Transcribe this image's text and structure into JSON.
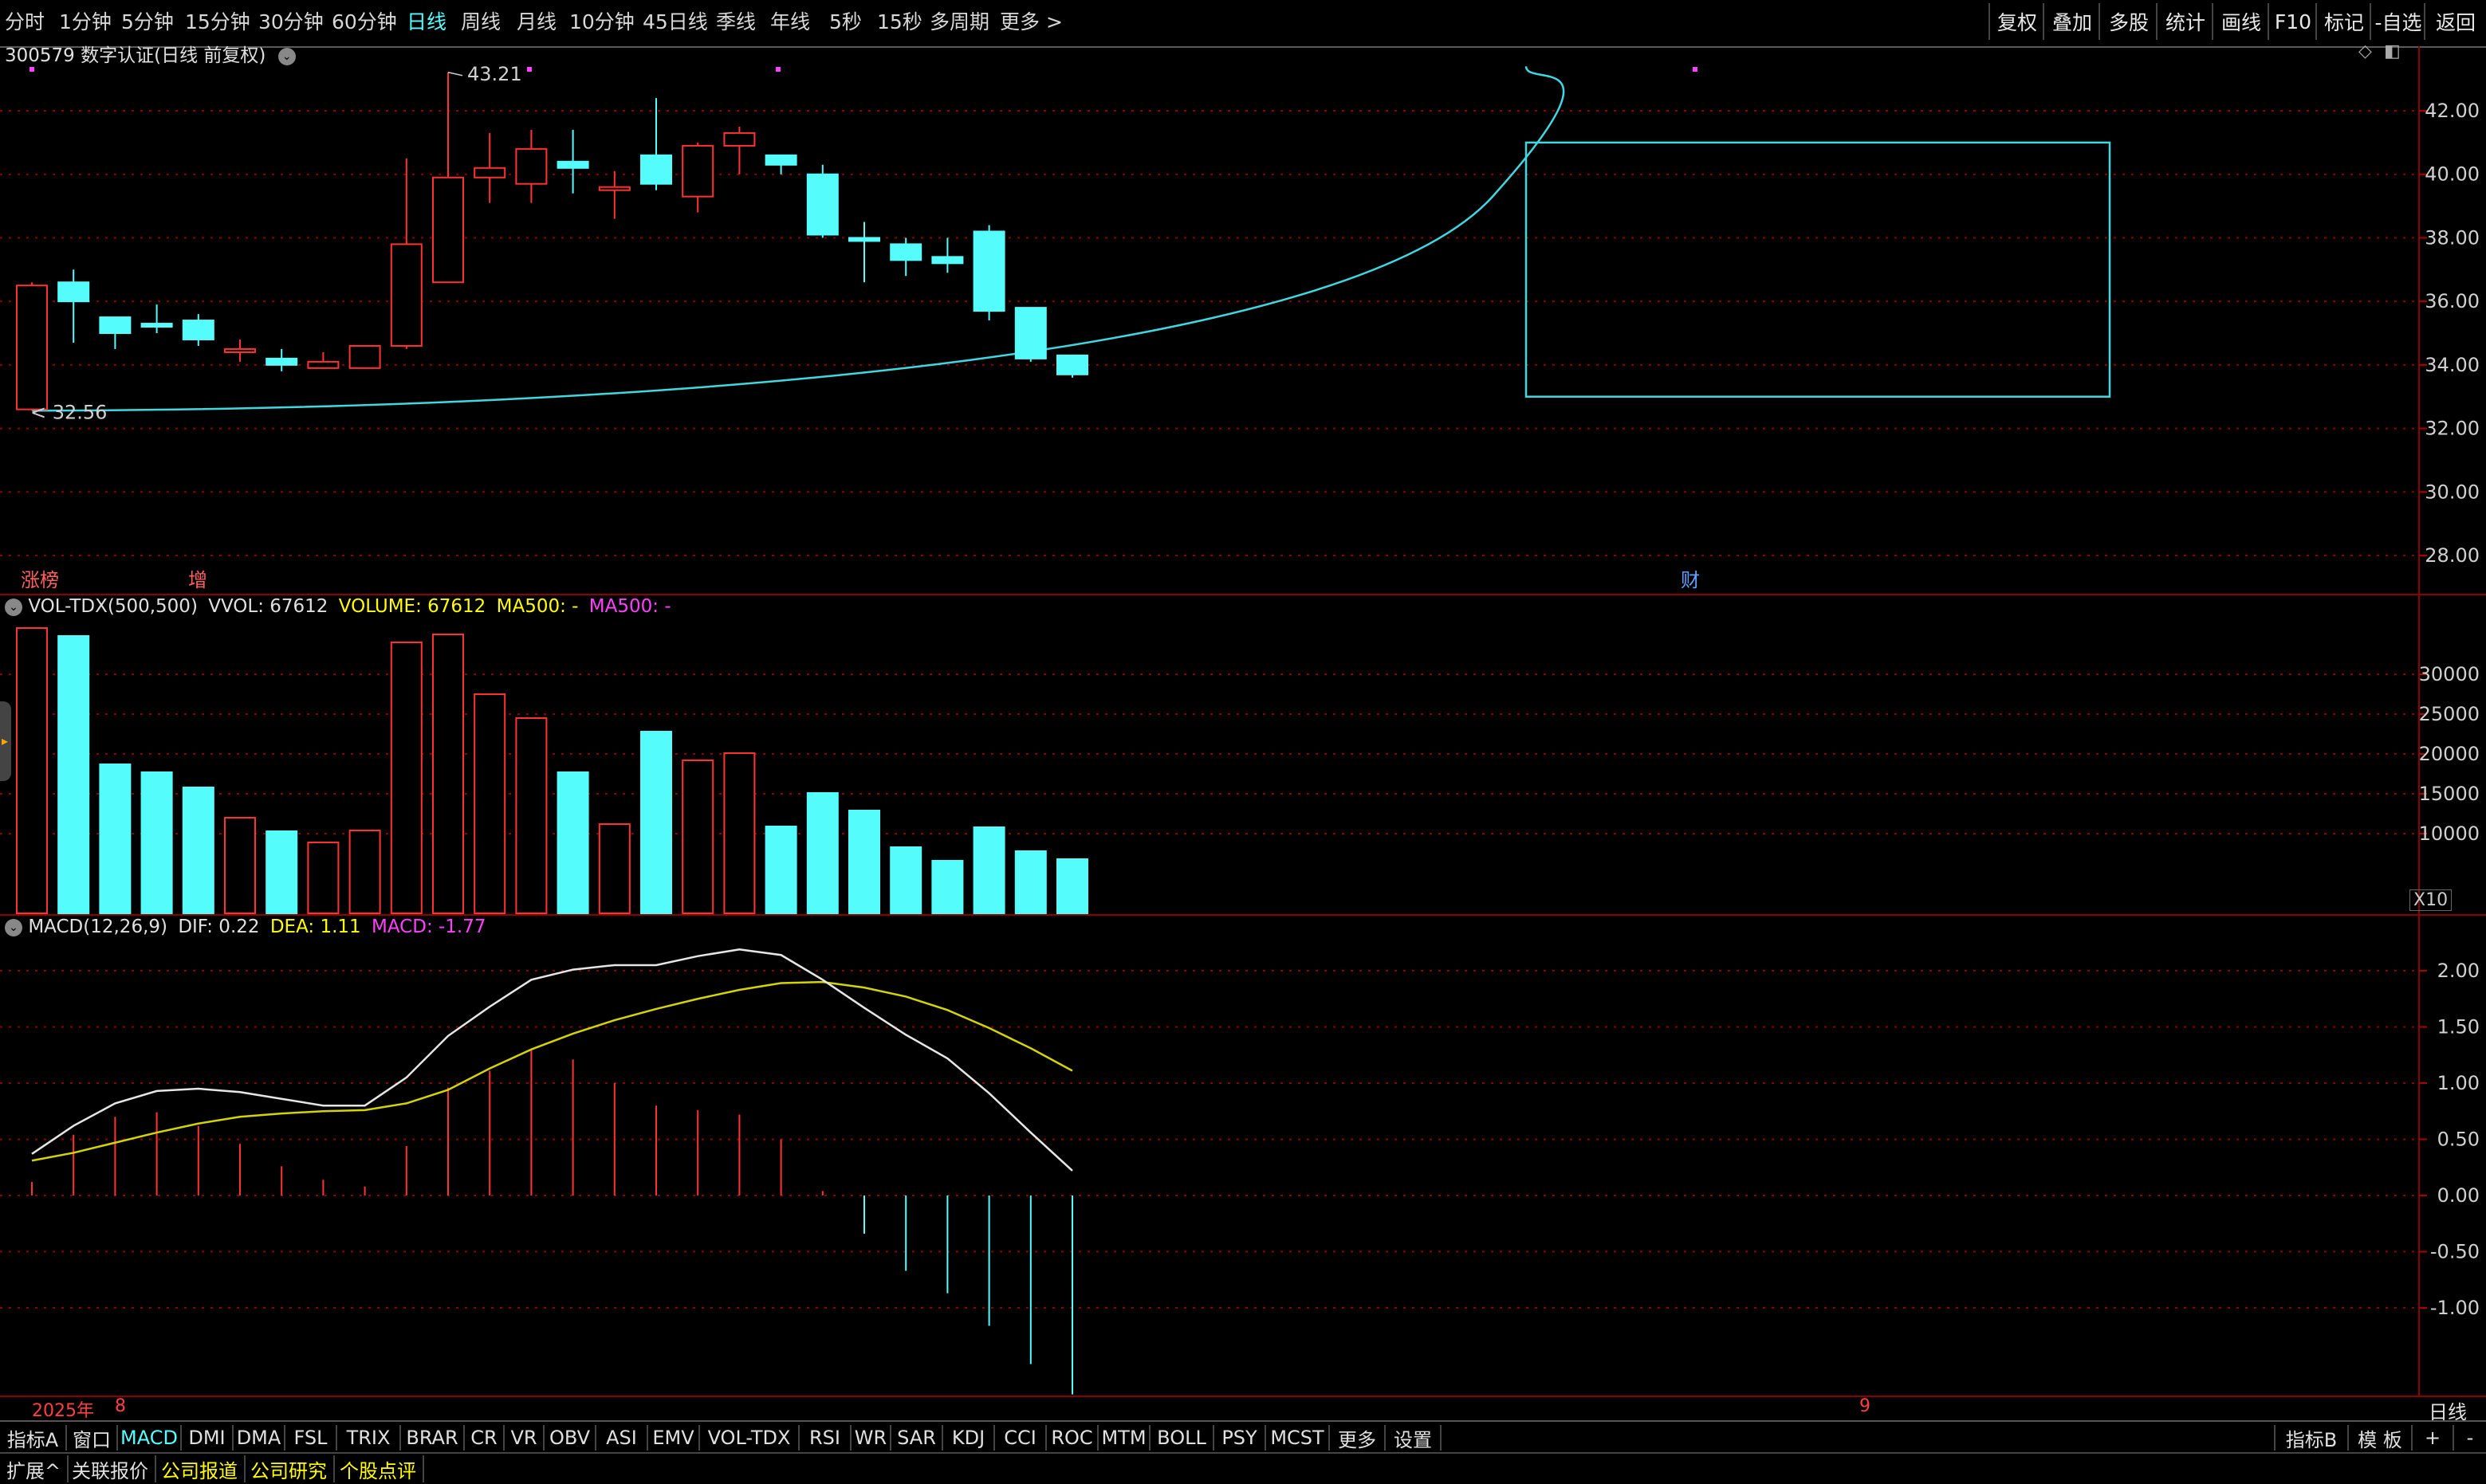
{
  "toolbar": {
    "periods": [
      "分时",
      "1分钟",
      "5分钟",
      "15分钟",
      "30分钟",
      "60分钟",
      "日线",
      "周线",
      "月线",
      "10分钟",
      "45日线",
      "季线",
      "年线",
      "5秒",
      "15秒",
      "多周期",
      "更多 >"
    ],
    "active_period": "日线",
    "right_buttons": [
      "复权",
      "叠加",
      "多股",
      "统计",
      "画线",
      "F10",
      "标记",
      "-自选",
      "返回"
    ]
  },
  "main_panel": {
    "title": "300579 数字认证(日线 前复权)",
    "high_label": "43.21",
    "low_label": "32.56",
    "y_ticks": [
      "42.00",
      "40.00",
      "38.00",
      "36.00",
      "34.00",
      "32.00",
      "30.00",
      "28.00"
    ],
    "markers": [
      "涨榜",
      "增",
      "财"
    ]
  },
  "volume_panel": {
    "title": "VOL-TDX(500,500)",
    "vvol": "VVOL: 67612",
    "volume": "VOLUME: 67612",
    "ma500_1": "MA500: -",
    "ma500_2": "MA500: -",
    "y_ticks": [
      "30000",
      "25000",
      "20000",
      "15000",
      "10000"
    ],
    "unit": "X10"
  },
  "macd_panel": {
    "title": "MACD(12,26,9)",
    "dif": "DIF: 0.22",
    "dea": "DEA: 1.11",
    "macd": "MACD: -1.77",
    "y_ticks": [
      "2.00",
      "1.50",
      "1.00",
      "0.50",
      "0.00",
      "-0.50",
      "-1.00"
    ]
  },
  "time_axis": {
    "year": "2025年",
    "month_8": "8",
    "month_9": "9",
    "period_label": "日线"
  },
  "indicator_tabs": {
    "left_label": "指标A",
    "window_label": "窗口",
    "tabs": [
      "MACD",
      "DMI",
      "DMA",
      "FSL",
      "TRIX",
      "BRAR",
      "CR",
      "VR",
      "OBV",
      "ASI",
      "EMV",
      "VOL-TDX",
      "RSI",
      "WR",
      "SAR",
      "KDJ",
      "CCI",
      "ROC",
      "MTM",
      "BOLL",
      "PSY",
      "MCST",
      "更多",
      "设置"
    ],
    "active": "MACD",
    "right_labels": [
      "指标B",
      "模 板",
      "+",
      "-"
    ]
  },
  "bottom_bar": {
    "items": [
      "扩展^",
      "关联报价",
      "公司报道",
      "公司研究",
      "个股点评"
    ]
  },
  "colors": {
    "up": "#ff3232",
    "down": "#54fcfc",
    "dif_line": "#e6e6e6",
    "dea_line": "#d4d400",
    "grid": "#8b0000",
    "macd_value": "#ff40ff",
    "volume_label": "#ffff00"
  },
  "chart_data": {
    "type": "candlestick",
    "ohlc": [
      [
        32.6,
        36.5,
        32.56,
        36.6
      ],
      [
        36.6,
        36.0,
        34.7,
        37.0
      ],
      [
        35.5,
        35.0,
        34.5,
        35.5
      ],
      [
        35.3,
        35.2,
        35.0,
        35.9
      ],
      [
        35.4,
        34.8,
        34.6,
        35.6
      ],
      [
        34.4,
        34.5,
        34.1,
        34.8
      ],
      [
        34.2,
        34.0,
        33.8,
        34.5
      ],
      [
        33.9,
        34.1,
        33.9,
        34.4
      ],
      [
        33.9,
        34.6,
        33.9,
        34.6
      ],
      [
        34.6,
        37.8,
        34.5,
        40.5
      ],
      [
        36.6,
        39.9,
        36.6,
        43.21
      ],
      [
        39.9,
        40.2,
        39.1,
        41.3
      ],
      [
        39.7,
        40.8,
        39.1,
        41.4
      ],
      [
        40.4,
        40.2,
        39.4,
        41.4
      ],
      [
        39.5,
        39.6,
        38.6,
        40.1
      ],
      [
        40.6,
        39.7,
        39.5,
        42.4
      ],
      [
        39.3,
        40.9,
        38.8,
        41.0
      ],
      [
        40.9,
        41.3,
        40.0,
        41.5
      ],
      [
        40.6,
        40.3,
        40.0,
        40.6
      ],
      [
        40.0,
        38.1,
        38.0,
        40.3
      ],
      [
        38.0,
        37.9,
        36.6,
        38.5
      ],
      [
        37.8,
        37.3,
        36.8,
        38.0
      ],
      [
        37.4,
        37.2,
        36.9,
        38.0
      ],
      [
        38.2,
        35.7,
        35.4,
        38.4
      ],
      [
        35.8,
        34.2,
        34.1,
        35.8
      ],
      [
        34.3,
        33.7,
        33.6,
        34.3
      ]
    ],
    "volume": [
      35800,
      34800,
      18700,
      17700,
      15800,
      12000,
      10300,
      8900,
      10400,
      34000,
      35000,
      27500,
      24500,
      17700,
      11200,
      22800,
      19200,
      20100,
      10900,
      15100,
      12900,
      8300,
      6600,
      10800,
      7800,
      6800
    ],
    "dif": [
      0.37,
      0.62,
      0.82,
      0.93,
      0.95,
      0.92,
      0.86,
      0.8,
      0.8,
      1.05,
      1.42,
      1.68,
      1.92,
      2.01,
      2.05,
      2.05,
      2.13,
      2.19,
      2.14,
      1.92,
      1.67,
      1.43,
      1.22,
      0.91,
      0.56,
      0.22
    ],
    "dea": [
      0.31,
      0.38,
      0.47,
      0.56,
      0.64,
      0.7,
      0.73,
      0.75,
      0.76,
      0.82,
      0.94,
      1.13,
      1.3,
      1.44,
      1.56,
      1.66,
      1.75,
      1.83,
      1.89,
      1.9,
      1.85,
      1.77,
      1.65,
      1.49,
      1.31,
      1.11
    ],
    "macd": [
      0.12,
      0.54,
      0.7,
      0.74,
      0.62,
      0.46,
      0.26,
      0.14,
      0.08,
      0.44,
      0.96,
      1.11,
      1.3,
      1.21,
      1.0,
      0.8,
      0.76,
      0.72,
      0.5,
      0.04,
      -0.34,
      -0.67,
      -0.87,
      -1.16,
      -1.5,
      -1.77
    ],
    "ylim_price": [
      26.6,
      44.0
    ],
    "ylim_volume": [
      0,
      36000
    ],
    "ylim_macd": [
      -1.77,
      2.45
    ],
    "x_labels": [
      "2025年",
      "8",
      "9"
    ],
    "series_names": [
      "DIF",
      "DEA",
      "MACD"
    ]
  }
}
